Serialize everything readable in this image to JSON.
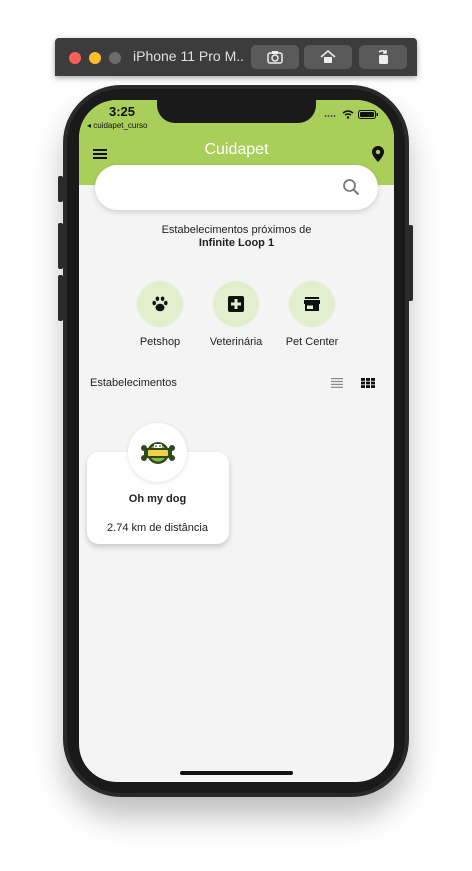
{
  "simulator": {
    "title": "iPhone 11 Pro M...",
    "buttons": [
      "screenshot-icon",
      "home-icon",
      "rotate-icon"
    ]
  },
  "status_bar": {
    "time": "3:25",
    "back_app": "◂ cuidapet_curso",
    "icons": [
      "signal-icon",
      "wifi-icon",
      "battery-icon"
    ]
  },
  "app_bar": {
    "title": "Cuidapet",
    "left_icon": "menu-icon",
    "right_icon": "location-pin-icon",
    "color": "#a9cf5a"
  },
  "search": {
    "value": "",
    "placeholder": "",
    "icon": "search-icon"
  },
  "location": {
    "label": "Estabelecimentos próximos de",
    "place": "Infinite Loop 1"
  },
  "categories": [
    {
      "label": "Petshop",
      "icon": "paw-icon"
    },
    {
      "label": "Veterinária",
      "icon": "medical-cross-icon"
    },
    {
      "label": "Pet Center",
      "icon": "store-icon"
    }
  ],
  "establishments": {
    "section_label": "Estabelecimentos",
    "view_modes": [
      "list-view-icon",
      "grid-view-icon"
    ],
    "selected_view": "grid",
    "items": [
      {
        "name": "Oh my dog",
        "distance": "2.74 km de distância",
        "logo": "dog-bone-logo"
      }
    ]
  }
}
